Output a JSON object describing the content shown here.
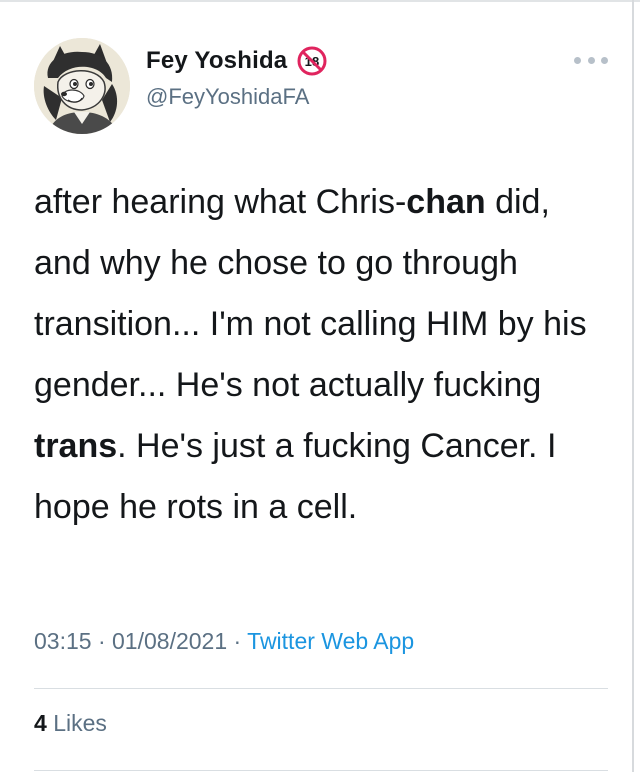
{
  "author": {
    "display_name": "Fey Yoshida",
    "handle": "@FeyYoshidaFA",
    "badge": "18-plus-badge-icon",
    "badge_text": "18"
  },
  "tweet": {
    "segments": [
      {
        "text": "after hearing what Chris-",
        "bold": false
      },
      {
        "text": "chan",
        "bold": true
      },
      {
        "text": " did, and why he chose to go through transition... I'm not calling HIM by his gender... He's not actually fucking ",
        "bold": false
      },
      {
        "text": "trans",
        "bold": true
      },
      {
        "text": ". He's just a fucking Cancer. I hope he rots in a cell.",
        "bold": false
      }
    ]
  },
  "meta": {
    "time": "03:15",
    "date": "01/08/2021",
    "separator": " · ",
    "source": "Twitter Web App"
  },
  "stats": {
    "likes_count": "4",
    "likes_label": "Likes"
  },
  "colors": {
    "text": "#14171a",
    "secondary": "#5b7083",
    "link": "#1b95e0",
    "badge_red": "#e0245e"
  }
}
